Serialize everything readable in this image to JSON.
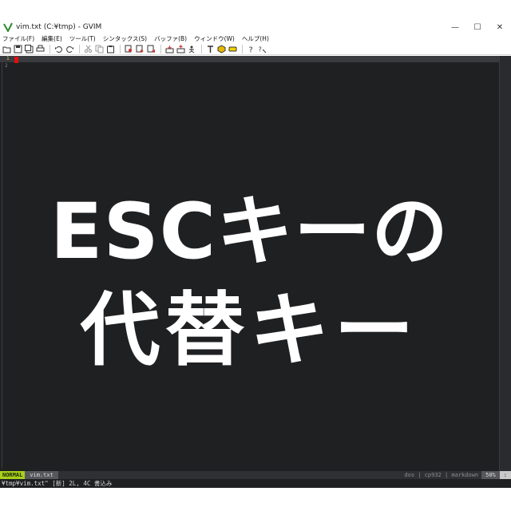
{
  "window": {
    "title": "vim.txt (C:¥tmp) - GVIM",
    "controls": {
      "minimize": "—",
      "maximize": "☐",
      "close": "✕"
    }
  },
  "menubar": {
    "items": [
      {
        "label": "ファイル(F)"
      },
      {
        "label": "編集(E)"
      },
      {
        "label": "ツール(T)"
      },
      {
        "label": "シンタックス(S)"
      },
      {
        "label": "バッファ(B)"
      },
      {
        "label": "ウィンドウ(W)"
      },
      {
        "label": "ヘルプ(H)"
      }
    ]
  },
  "toolbar": {
    "buttons": [
      "open-icon",
      "save-icon",
      "save-all-icon",
      "print-icon",
      "undo-icon",
      "redo-icon",
      "cut-icon",
      "copy-icon",
      "paste-icon",
      "find-replace-icon",
      "find-next-icon",
      "find-prev-icon",
      "load-session-icon",
      "save-session-icon",
      "run-script-icon",
      "make-icon",
      "build-tags-icon",
      "jump-tag-icon",
      "help-icon",
      "find-help-icon"
    ]
  },
  "editor": {
    "line_numbers": [
      "1",
      "2"
    ],
    "content": {
      "line1": "ESCキーの",
      "line2": "代替キー"
    }
  },
  "statusline": {
    "mode": "NORMAL",
    "filename": "vim.txt",
    "right_info": "dos | cp932 | markdown",
    "percent": "50%",
    "position": ":"
  },
  "cmdline": {
    "text": "¥tmp¥vim.txt\" [新] 2L, 4C 書込み"
  },
  "colors": {
    "editor_bg": "#1f2022",
    "mode_bg": "#a8d01c",
    "cursor": "#e01010"
  }
}
